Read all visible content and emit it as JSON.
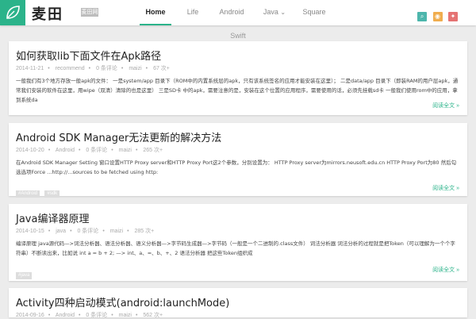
{
  "header": {
    "logo_text": "麦田",
    "logo_badge": "麦田网",
    "nav": [
      "Home",
      "Life",
      "Android",
      "Java",
      "Square"
    ],
    "java_caret": "⌄",
    "tools": [
      {
        "icon": "search-icon",
        "glyph": "⌕",
        "color": "#4db6ac"
      },
      {
        "icon": "rss-icon",
        "glyph": "◉",
        "color": "#f0ad4e"
      },
      {
        "icon": "weibo-icon",
        "glyph": "✦",
        "color": "#e57373"
      }
    ]
  },
  "subcategory": "Swift",
  "posts": [
    {
      "title": "如何获取lib下面文件在Apk路径",
      "date": "2014-11-21",
      "category": "recommend",
      "comments": "0 条评论",
      "author": "maizi",
      "views": "67 次+",
      "excerpt": "一般我们有3个地方存放一般apk的文件： 一是system/app 目录下（ROM中的内置系统层的apk，只有该系统签名的应用才能安装在这里）； 二是data/app    目录下（即装RAM的用户层apk，通常我们安装的软件在这里，用wipe（双清）清除的也是这里） 三是SD卡      中的apk，需要注意的是，安装在这个位置的应用程序，需要使用的话，必须先挂载sd卡 一般我们使用rom中的应用，拿到系统da",
      "tags": [],
      "read_more": "阅读全文 »"
    },
    {
      "title": "Android SDK Manager无法更新的解决方法",
      "date": "2014-10-20",
      "category": "Android",
      "comments": "0 条评论",
      "author": "maizi",
      "views": "265 次+",
      "excerpt": "在Android SDK Manager Setting 窗口设置HTTP Proxy server和HTTP Proxy Port这2个参数，分别设置为： HTTP Proxy server为mirrors.neusoft.edu.cn HTTP Proxy Port为80 然后勾选选项Force ...http://...sources to be fetched using http:",
      "tags": [
        "#Android",
        "#sdk"
      ],
      "read_more": "阅读全文 »"
    },
    {
      "title": "Java编译器原理",
      "date": "2014-10-15",
      "category": "java",
      "comments": "0 条评论",
      "author": "maizi",
      "views": "285 次+",
      "excerpt": "编译原理 java源代码—>词法分析器、语法分析器、语义分析器—>字节码生成器—>字节码（一般是一个二进制的.class文件）    词法分析器 词法分析的过程就是把Token（可以理解为一个个字符串）不断读出来，比如说 int a = b + 2; —> int、a、=、b、+、2 语法分析器 把这些Token组织成",
      "tags": [
        "#java"
      ],
      "read_more": "阅读全文 »"
    },
    {
      "title": "Activity四种启动模式(android:launchMode)",
      "date": "2014-09-16",
      "category": "Android",
      "comments": "0 条评论",
      "author": "maizi",
      "views": "562 次+",
      "excerpt": "",
      "tags": [],
      "read_more": ""
    }
  ]
}
